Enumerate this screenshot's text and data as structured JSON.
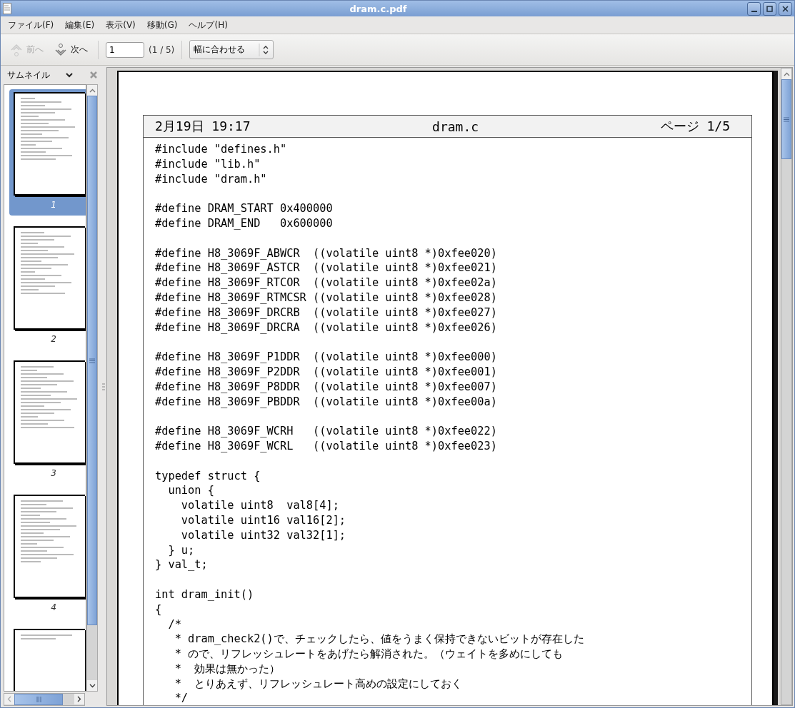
{
  "window": {
    "title": "dram.c.pdf"
  },
  "menu": [
    "ファイル(F)",
    "編集(E)",
    "表示(V)",
    "移動(G)",
    "ヘルプ(H)"
  ],
  "toolbar": {
    "prev": {
      "label": "前へ",
      "disabled": true
    },
    "next": {
      "label": "次へ",
      "disabled": false
    },
    "page_value": "1",
    "page_count": "(1 / 5)",
    "zoom": "幅に合わせる"
  },
  "sidebar": {
    "title": "サムネイル",
    "thumbnails": [
      {
        "label": "1",
        "selected": true
      },
      {
        "label": "2",
        "selected": false
      },
      {
        "label": "3",
        "selected": false
      },
      {
        "label": "4",
        "selected": false
      },
      {
        "selected": false
      }
    ]
  },
  "document": {
    "header": {
      "date": "2月19日 19:17",
      "file": "dram.c",
      "page": "ページ 1/5"
    },
    "blocks": [
      [
        "#include \"defines.h\"",
        "#include \"lib.h\"",
        "#include \"dram.h\""
      ],
      [
        "#define DRAM_START 0x400000",
        "#define DRAM_END   0x600000"
      ],
      [
        "#define H8_3069F_ABWCR  ((volatile uint8 *)0xfee020)",
        "#define H8_3069F_ASTCR  ((volatile uint8 *)0xfee021)",
        "#define H8_3069F_RTCOR  ((volatile uint8 *)0xfee02a)",
        "#define H8_3069F_RTMCSR ((volatile uint8 *)0xfee028)",
        "#define H8_3069F_DRCRB  ((volatile uint8 *)0xfee027)",
        "#define H8_3069F_DRCRA  ((volatile uint8 *)0xfee026)"
      ],
      [
        "#define H8_3069F_P1DDR  ((volatile uint8 *)0xfee000)",
        "#define H8_3069F_P2DDR  ((volatile uint8 *)0xfee001)",
        "#define H8_3069F_P8DDR  ((volatile uint8 *)0xfee007)",
        "#define H8_3069F_PBDDR  ((volatile uint8 *)0xfee00a)"
      ],
      [
        "#define H8_3069F_WCRH   ((volatile uint8 *)0xfee022)",
        "#define H8_3069F_WCRL   ((volatile uint8 *)0xfee023)"
      ],
      [
        "typedef struct {",
        "  union {",
        "    volatile uint8  val8[4];",
        "    volatile uint16 val16[2];",
        "    volatile uint32 val32[1];",
        "  } u;",
        "} val_t;"
      ],
      [
        "int dram_init()",
        "{",
        "  /*",
        "   * dram_check2()で、チェックしたら、値をうまく保持できないビットが存在した",
        "   * ので、リフレッシュレートをあげたら解消された。（ウェイトを多めにしても",
        "   *  効果は無かった）",
        "   *  とりあえず、リフレッシュレート高めの設定にしておく",
        "   */"
      ]
    ]
  }
}
